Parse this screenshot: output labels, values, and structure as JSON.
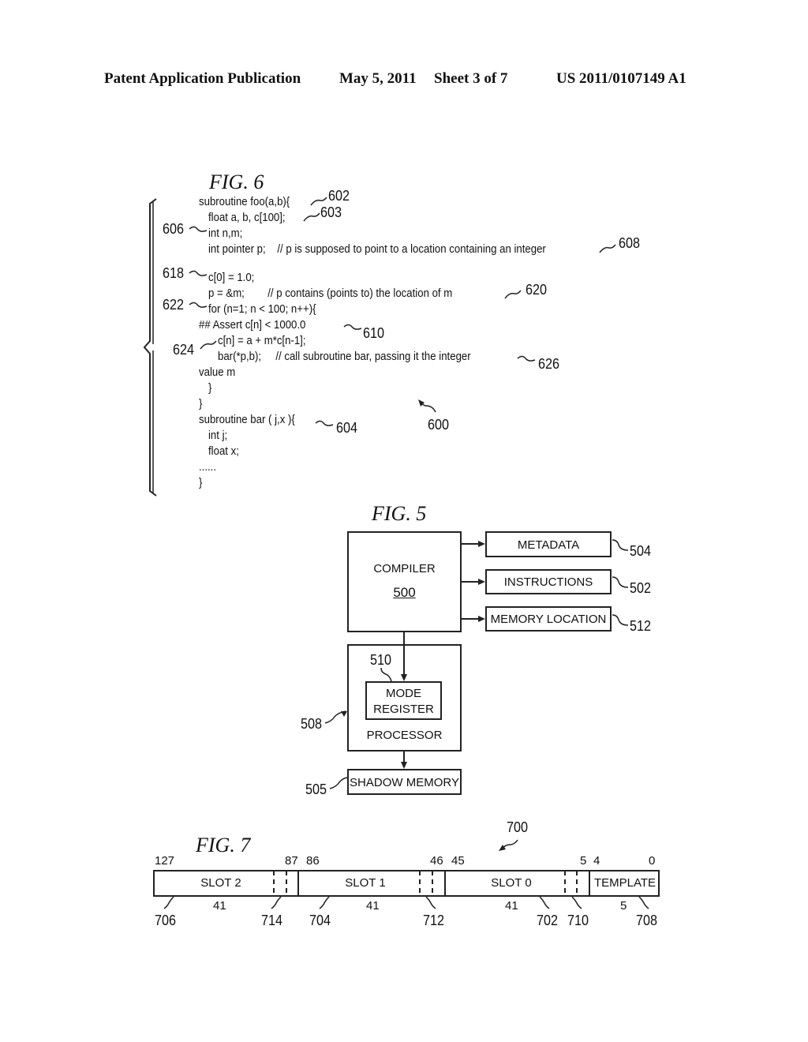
{
  "header": {
    "left": "Patent Application Publication",
    "date": "May 5, 2011",
    "sheet": "Sheet 3 of 7",
    "number": "US 2011/0107149 A1"
  },
  "fig6": {
    "title": "FIG. 6",
    "code_lines": [
      "subroutine foo(a,b){",
      "float a, b, c[100];",
      "int n,m;",
      "int pointer p;    // p is supposed to point to a location containing an integer",
      "c[0] = 1.0;",
      "p = &m;        // p contains (points to) the location of m",
      "for (n=1; n < 100; n++){",
      "## Assert c[n] < 1000.0",
      "c[n] = a + m*c[n-1];",
      "bar(*p,b);     // call subroutine bar, passing it the integer",
      "value m",
      "}",
      "}",
      "subroutine bar ( j,x ){",
      "int j;",
      "float x;",
      "......",
      "}"
    ],
    "refs": {
      "r602": "602",
      "r603": "603",
      "r606": "606",
      "r608": "608",
      "r618": "618",
      "r620": "620",
      "r622": "622",
      "r610": "610",
      "r624": "624",
      "r626": "626",
      "r604": "604",
      "r600": "600"
    }
  },
  "fig5": {
    "title": "FIG. 5",
    "compiler": {
      "label": "COMPILER",
      "num": "500"
    },
    "metadata": "METADATA",
    "instructions": "INSTRUCTIONS",
    "memory_location": "MEMORY LOCATION",
    "mode_register": [
      "MODE",
      "REGISTER"
    ],
    "processor": "PROCESSOR",
    "shadow_memory": "SHADOW MEMORY",
    "refs": {
      "r504": "504",
      "r502": "502",
      "r512": "512",
      "r510": "510",
      "r508": "508",
      "r505": "505"
    }
  },
  "fig7": {
    "title": "FIG. 7",
    "ref_main": "700",
    "bit_labels": [
      "127",
      "87",
      "86",
      "46",
      "45",
      "5",
      "4",
      "0"
    ],
    "slots": [
      {
        "label": "SLOT 2",
        "width": "41",
        "ref": "706",
        "tag_ref": "714"
      },
      {
        "label": "SLOT 1",
        "width": "41",
        "ref": "704",
        "tag_ref": "712"
      },
      {
        "label": "SLOT 0",
        "width": "41",
        "ref": "702",
        "tag_ref": "710"
      },
      {
        "label": "TEMPLATE",
        "width": "5",
        "ref": "708"
      }
    ]
  }
}
